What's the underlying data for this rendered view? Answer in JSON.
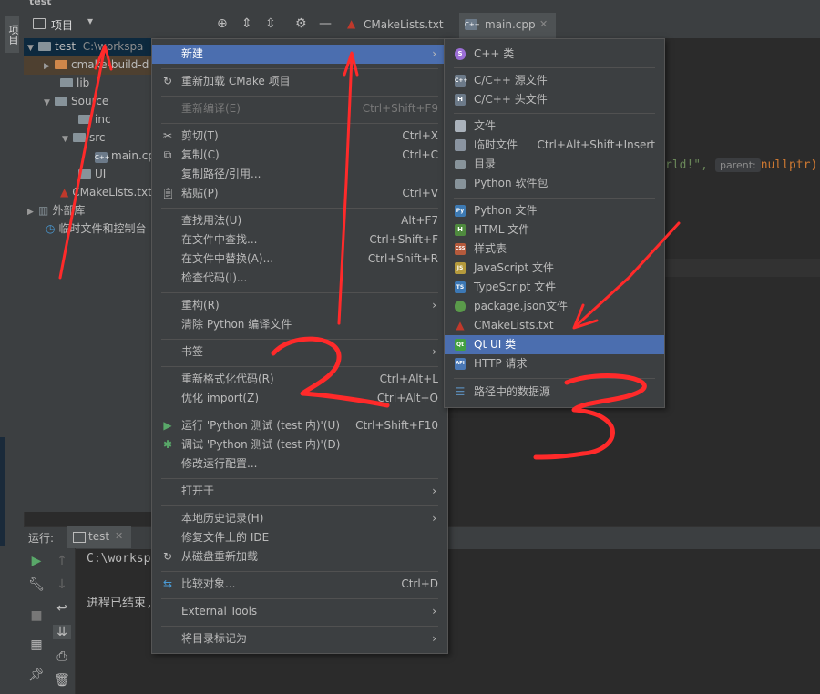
{
  "window": {
    "title": "test"
  },
  "side_tool": {
    "project_label": "项目"
  },
  "project_panel": {
    "title": "项目",
    "header_icons": [
      "crosshair-icon",
      "expand-icon",
      "collapse-icon",
      "gear-icon",
      "minimize-icon"
    ]
  },
  "tabs": [
    {
      "label": "CMakeLists.txt",
      "icon": "cmake-icon"
    },
    {
      "label": "main.cpp",
      "icon": "cpp-file-icon",
      "active": true
    }
  ],
  "tree": [
    {
      "label": "test",
      "suffix": "C:\\workspa",
      "icon": "folder-icon"
    },
    {
      "label": "cmake-build-d",
      "icon": "folder-orange-icon"
    },
    {
      "label": "lib",
      "icon": "folder-icon"
    },
    {
      "label": "Source",
      "icon": "folder-icon"
    },
    {
      "label": "inc",
      "icon": "folder-icon"
    },
    {
      "label": "src",
      "icon": "folder-icon"
    },
    {
      "label": "main.cp",
      "icon": "cpp-file-icon"
    },
    {
      "label": "UI",
      "icon": "folder-icon"
    },
    {
      "label": "CMakeLists.txt",
      "icon": "cmake-icon"
    },
    {
      "label": "外部库",
      "icon": "library-icon"
    },
    {
      "label": "临时文件和控制台",
      "icon": "scratch-icon"
    }
  ],
  "editor": {
    "code_text": "rld!\",",
    "hint": "parent:",
    "code_tail": "nullptr)"
  },
  "run_panel": {
    "label": "运行:",
    "tab": "test",
    "output_line1": "C:\\workspa",
    "output_line2": "进程已结束,"
  },
  "context_menu": [
    {
      "label": "新建",
      "arrow": true,
      "selected": true
    },
    {
      "label": "重新加载 CMake 项目",
      "icon": "reload-icon"
    },
    {
      "label": "重新编译(E)",
      "shortcut": "Ctrl+Shift+F9",
      "disabled": true
    },
    {
      "label": "剪切(T)",
      "shortcut": "Ctrl+X",
      "icon": "scissors-icon"
    },
    {
      "label": "复制(C)",
      "shortcut": "Ctrl+C",
      "icon": "copy-icon"
    },
    {
      "label": "复制路径/引用..."
    },
    {
      "label": "粘贴(P)",
      "shortcut": "Ctrl+V",
      "icon": "paste-icon"
    },
    {
      "label": "查找用法(U)",
      "shortcut": "Alt+F7"
    },
    {
      "label": "在文件中查找...",
      "shortcut": "Ctrl+Shift+F"
    },
    {
      "label": "在文件中替换(A)...",
      "shortcut": "Ctrl+Shift+R"
    },
    {
      "label": "检查代码(I)..."
    },
    {
      "label": "重构(R)",
      "arrow": true
    },
    {
      "label": "清除 Python 编译文件"
    },
    {
      "label": "书签",
      "arrow": true
    },
    {
      "label": "重新格式化代码(R)",
      "shortcut": "Ctrl+Alt+L"
    },
    {
      "label": "优化 import(Z)",
      "shortcut": "Ctrl+Alt+O"
    },
    {
      "label": "运行 'Python 测试 (test 内)'(U)",
      "shortcut": "Ctrl+Shift+F10",
      "icon": "run-icon"
    },
    {
      "label": "调试 'Python 测试 (test 内)'(D)",
      "icon": "debug-icon"
    },
    {
      "label": "修改运行配置..."
    },
    {
      "label": "打开于",
      "arrow": true
    },
    {
      "label": "本地历史记录(H)",
      "arrow": true
    },
    {
      "label": "修复文件上的 IDE"
    },
    {
      "label": "从磁盘重新加载",
      "icon": "reload-icon"
    },
    {
      "label": "比较对象...",
      "shortcut": "Ctrl+D",
      "icon": "compare-icon"
    },
    {
      "label": "External Tools",
      "arrow": true
    },
    {
      "label": "将目录标记为",
      "arrow": true
    }
  ],
  "submenu": [
    {
      "label": "C++ 类",
      "badge": "S",
      "color": "#9b6ed6"
    },
    {
      "label": "C/C++ 源文件",
      "badge": "C++",
      "color": "#6c7a89"
    },
    {
      "label": "C/C++ 头文件",
      "badge": "H",
      "color": "#6c7a89"
    },
    {
      "label": "文件",
      "badge": "",
      "color": "#aab2bb"
    },
    {
      "label": "临时文件",
      "shortcut": "Ctrl+Alt+Shift+Insert",
      "badge": "",
      "color": "#8a94a0"
    },
    {
      "label": "目录",
      "badge": "",
      "color": "#87939a"
    },
    {
      "label": "Python 软件包",
      "badge": "",
      "color": "#87939a"
    },
    {
      "label": "Python 文件",
      "badge": "Py",
      "color": "#3d7ab3"
    },
    {
      "label": "HTML 文件",
      "badge": "H",
      "color": "#4f8a3e"
    },
    {
      "label": "样式表",
      "badge": "CSS",
      "color": "#b55a3c"
    },
    {
      "label": "JavaScript 文件",
      "badge": "JS",
      "color": "#b59a3c"
    },
    {
      "label": "TypeScript 文件",
      "badge": "TS",
      "color": "#3c78b5"
    },
    {
      "label": "package.json文件",
      "badge": "",
      "color": "#5a9a4a"
    },
    {
      "label": "CMakeLists.txt",
      "badge": "",
      "color": "#c0392b"
    },
    {
      "label": "Qt UI 类",
      "badge": "Qt",
      "color": "#41a041",
      "selected": true
    },
    {
      "label": "HTTP 请求",
      "badge": "API",
      "color": "#4a78b5"
    },
    {
      "label": "路径中的数据源",
      "badge": "",
      "color": "#5a8ab5"
    }
  ],
  "colors": {
    "background": "#2b2b2b",
    "panel": "#3c3f41",
    "selection": "#4b6eaf",
    "annotation": "#ff2a2a"
  }
}
